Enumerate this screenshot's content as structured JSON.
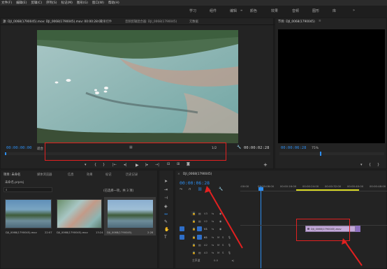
{
  "menu": [
    "文件(F)",
    "编辑(E)",
    "剪辑(C)",
    "序列(S)",
    "标记(M)",
    "图形(G)",
    "窗口(W)",
    "帮助(H)"
  ],
  "workspaces": [
    "学习",
    "组件",
    "编辑",
    "颜色",
    "效果",
    "音频",
    "图形",
    "库"
  ],
  "workspace_more": "»",
  "source_panel": {
    "tabs": [
      "源: DJI_0068(1790045).mov: DJI_0068(1790045).mov: 00:00:28:07",
      "效果控件",
      "音频剪辑混合器: DJI_0068(1790045)",
      "元数据"
    ],
    "timecode": "00:00:00:00",
    "fit_label": "适合",
    "page_label": "1/2",
    "duration": "00:00:02:28"
  },
  "program_panel": {
    "tab": "节目: DJI_0068(1790045)",
    "timecode": "00:00:06:28",
    "zoom": "75%"
  },
  "project_panel": {
    "tabs": [
      "项目: 未命名",
      "媒体浏览器",
      "信息",
      "效果",
      "标记",
      "历史记录"
    ],
    "project_file": "未命名.prproj",
    "items_info": "(已选择一项，共 3 项)",
    "clips": [
      {
        "name": "DJI_0068(1790045).mov",
        "duration": "22:07"
      },
      {
        "name": "DJI_0068(1790045).mov",
        "duration": "13:24"
      },
      {
        "name": "DJI_0068(1790045)",
        "duration": "2:28"
      }
    ]
  },
  "timeline": {
    "tab": "DJI_0068(1790045)",
    "timecode": "00:00:06:28",
    "ruler": [
      ":00:00",
      "00:00:08:00",
      "00:00:16:00",
      "00:00:24:00",
      "00:00:32:00",
      "00:00:40:00",
      "00:00:48:00"
    ],
    "video_tracks": [
      "V3",
      "V2",
      "V1"
    ],
    "audio_tracks": [
      "A1",
      "A2",
      "A3"
    ],
    "master": "主声道",
    "master_value": "0.0",
    "clip_label": "DJI_0068(1790045).mov"
  },
  "colors": {
    "accent": "#2e8ef0",
    "annotation": "#e22020",
    "clip": "#c3a9d9"
  }
}
